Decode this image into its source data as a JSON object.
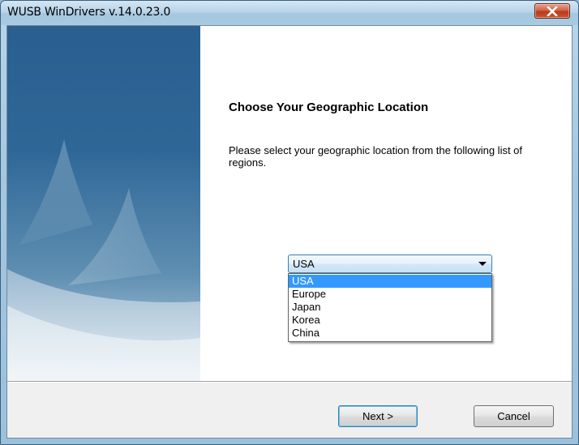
{
  "window": {
    "title": "WUSB WinDrivers v.14.0.23.0",
    "close_icon": "close-icon"
  },
  "page": {
    "heading": "Choose Your Geographic Location",
    "description": "Please select your geographic location from the following list of regions."
  },
  "region_select": {
    "selected": "USA",
    "options": [
      "USA",
      "Europe",
      "Japan",
      "Korea",
      "China"
    ],
    "highlighted_index": 0
  },
  "footer": {
    "next_label": "Next >",
    "cancel_label": "Cancel"
  },
  "colors": {
    "highlight": "#3399ff",
    "banner": "#2a5f90"
  }
}
